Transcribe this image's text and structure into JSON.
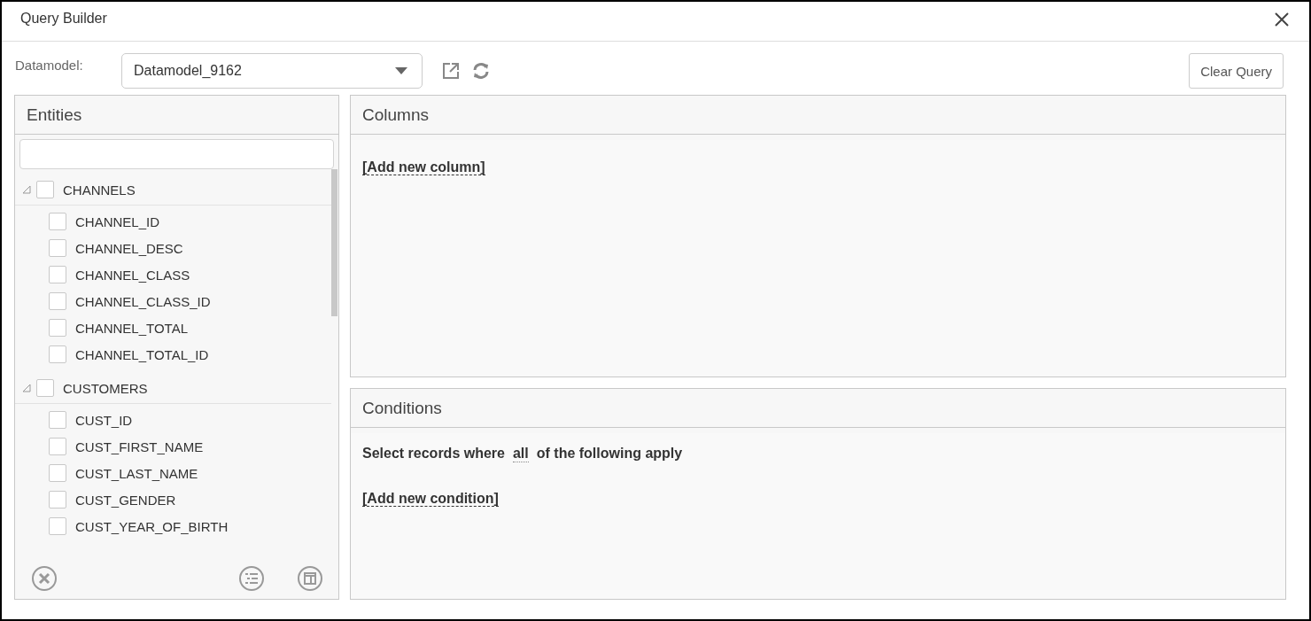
{
  "window": {
    "title": "Query Builder"
  },
  "toolbar": {
    "datamodel_label": "Datamodel:",
    "datamodel_value": "Datamodel_9162",
    "clear_button": "Clear Query"
  },
  "entities": {
    "title": "Entities",
    "groups": [
      {
        "name": "CHANNELS",
        "checked": false,
        "expanded": true,
        "children": [
          {
            "name": "CHANNEL_ID",
            "checked": false
          },
          {
            "name": "CHANNEL_DESC",
            "checked": false
          },
          {
            "name": "CHANNEL_CLASS",
            "checked": false
          },
          {
            "name": "CHANNEL_CLASS_ID",
            "checked": false
          },
          {
            "name": "CHANNEL_TOTAL",
            "checked": false
          },
          {
            "name": "CHANNEL_TOTAL_ID",
            "checked": false
          }
        ]
      },
      {
        "name": "CUSTOMERS",
        "checked": false,
        "expanded": true,
        "children": [
          {
            "name": "CUST_ID",
            "checked": false
          },
          {
            "name": "CUST_FIRST_NAME",
            "checked": false
          },
          {
            "name": "CUST_LAST_NAME",
            "checked": false
          },
          {
            "name": "CUST_GENDER",
            "checked": false
          },
          {
            "name": "CUST_YEAR_OF_BIRTH",
            "checked": false
          }
        ]
      }
    ]
  },
  "columns": {
    "title": "Columns",
    "add_link": "[Add new column]"
  },
  "conditions": {
    "title": "Conditions",
    "sentence_prefix": "Select records where",
    "quantifier": "all",
    "sentence_suffix": "of the following apply",
    "add_link": "[Add new condition]"
  }
}
